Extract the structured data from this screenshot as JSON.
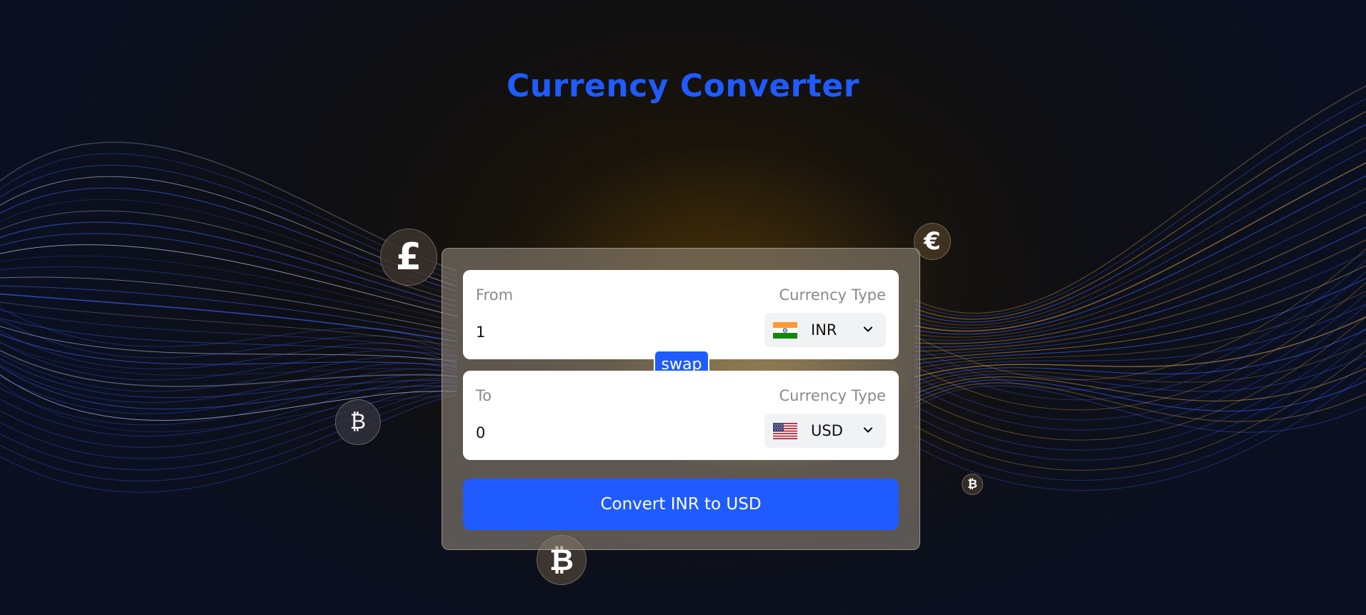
{
  "app": {
    "title": "Currency Converter"
  },
  "from": {
    "label": "From",
    "currency_type_label": "Currency Type",
    "amount": "1",
    "currency": "INR",
    "flag_icon": "india-flag-icon"
  },
  "to": {
    "label": "To",
    "currency_type_label": "Currency Type",
    "amount": "0",
    "currency": "USD",
    "flag_icon": "usa-flag-icon"
  },
  "swap_label": "swap",
  "convert_label": "Convert INR to USD",
  "decor": {
    "coins": [
      {
        "glyph": "£",
        "icon": "pound-coin-icon"
      },
      {
        "glyph": "€",
        "icon": "euro-coin-icon"
      },
      {
        "glyph": "₿",
        "icon": "bitcoin-coin-icon"
      },
      {
        "glyph": "₿",
        "icon": "bitcoin-coin-icon"
      },
      {
        "glyph": "₿",
        "icon": "bitcoin-coin-icon"
      }
    ]
  },
  "colors": {
    "accent": "#1f5bff",
    "background": "#0d0f14",
    "wave_blue": "#3f63ff",
    "wave_gold": "#d9a85a"
  }
}
